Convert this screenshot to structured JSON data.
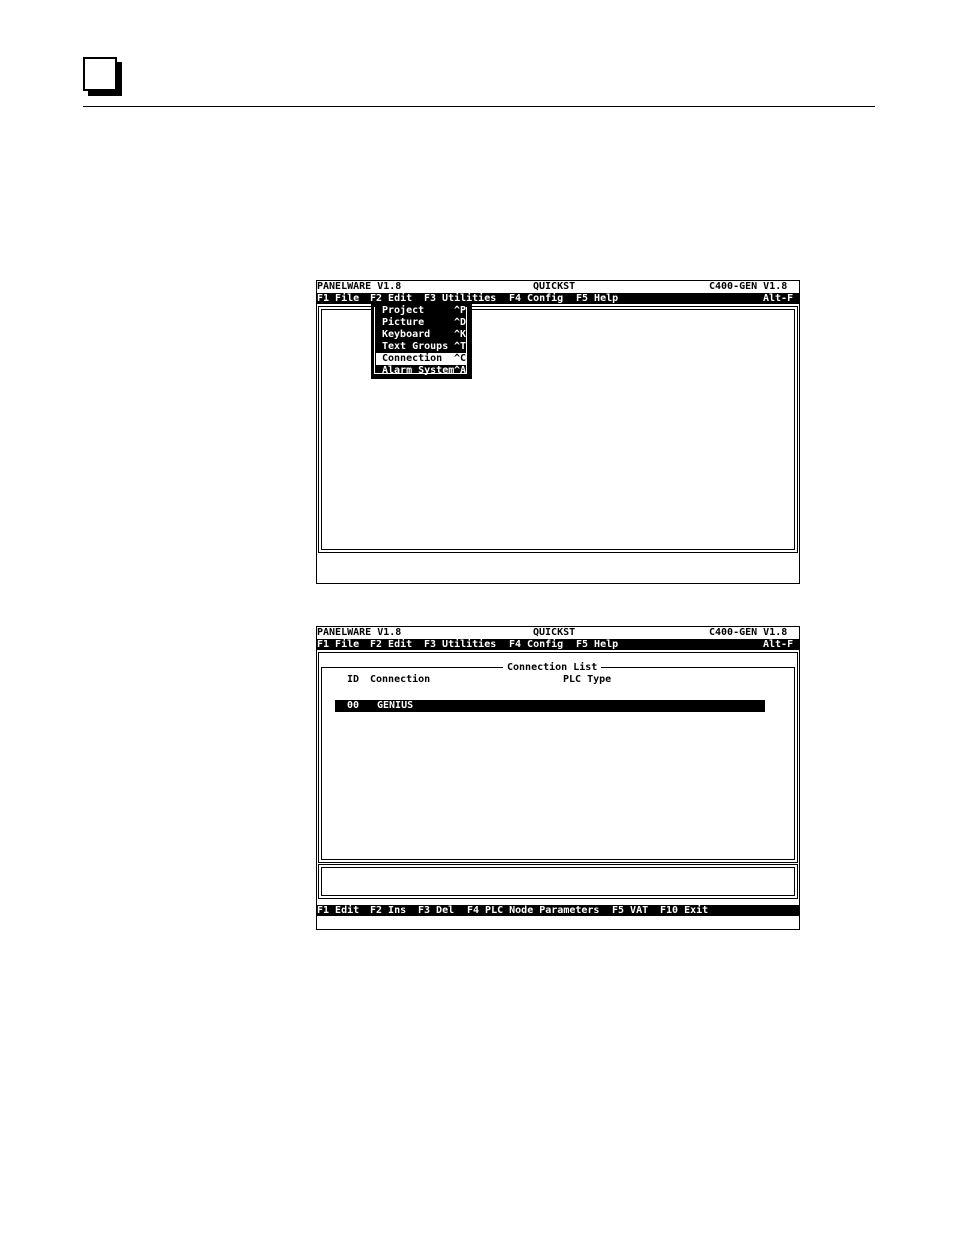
{
  "screen1": {
    "app": "PANELWARE V1.8",
    "project": "QUICKST",
    "version": "C400-GEN V1.8",
    "menubar": [
      {
        "label": "F1 File"
      },
      {
        "label": "F2 Edit"
      },
      {
        "label": "F3 Utilities"
      },
      {
        "label": "F4 Config"
      },
      {
        "label": "F5 Help"
      }
    ],
    "shortcut": "Alt-F",
    "edit_menu": [
      {
        "label": "Project",
        "key": "^P"
      },
      {
        "label": "Picture",
        "key": "^D"
      },
      {
        "label": "Keyboard",
        "key": "^K"
      },
      {
        "label": "Text Groups",
        "key": "^T"
      },
      {
        "label": "Connection",
        "key": "^C",
        "selected": true
      },
      {
        "label": "Alarm System",
        "key": "^A"
      }
    ]
  },
  "screen2": {
    "app": "PANELWARE V1.8",
    "project": "QUICKST",
    "version": "C400-GEN V1.8",
    "menubar": [
      {
        "label": "F1 File"
      },
      {
        "label": "F2 Edit"
      },
      {
        "label": "F3 Utilities"
      },
      {
        "label": "F4 Config"
      },
      {
        "label": "F5 Help"
      }
    ],
    "shortcut": "Alt-F",
    "window_title": "Connection List",
    "columns": {
      "id": "ID",
      "connection": "Connection",
      "plc_type": "PLC Type"
    },
    "rows": [
      {
        "id": "00",
        "connection": "GENIUS",
        "plc_type": ""
      }
    ],
    "function_keys": [
      {
        "label": "F1 Edit"
      },
      {
        "label": "F2 Ins"
      },
      {
        "label": "F3 Del"
      },
      {
        "label": "F4 PLC Node Parameters"
      },
      {
        "label": "F5 VAT"
      },
      {
        "label": "F10 Exit"
      }
    ]
  }
}
